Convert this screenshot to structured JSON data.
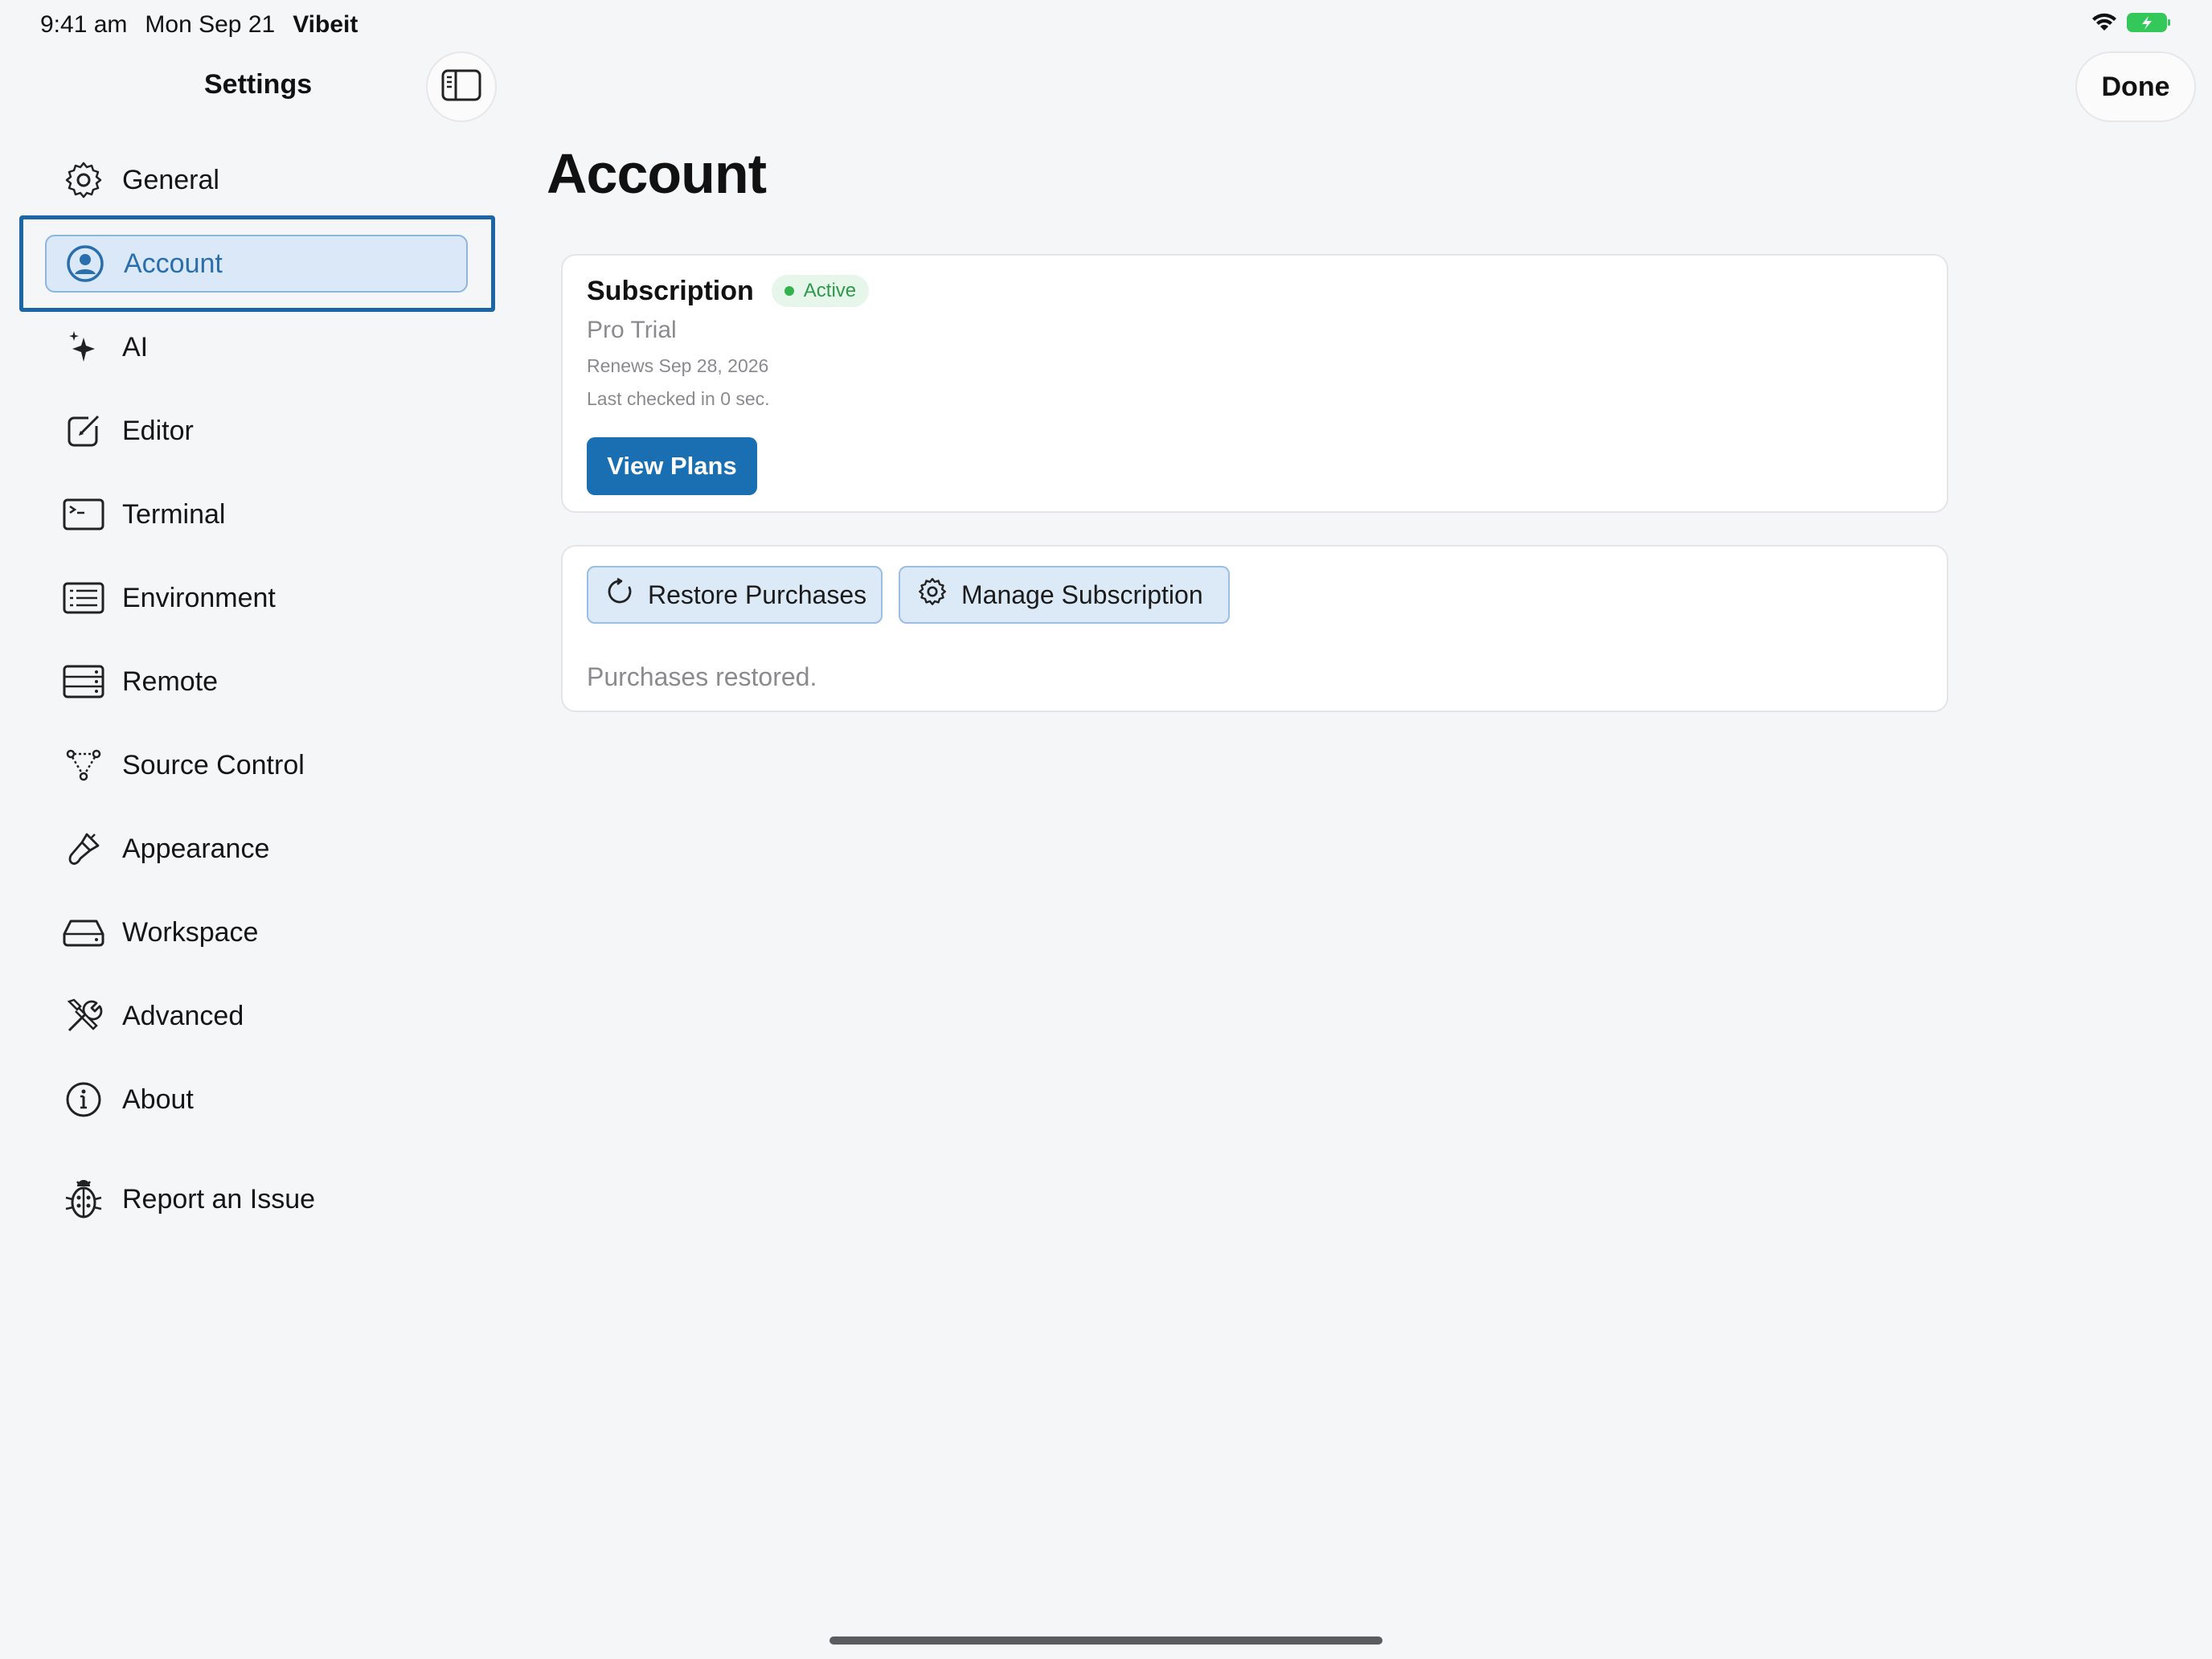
{
  "status_bar": {
    "time": "9:41 am",
    "date": "Mon Sep 21",
    "app": "Vibeit",
    "battery_color": "#34c759"
  },
  "sidebar": {
    "title": "Settings",
    "items": [
      {
        "label": "General",
        "icon": "gear-icon"
      },
      {
        "label": "Account",
        "icon": "person-circle-icon",
        "selected": true
      },
      {
        "label": "AI",
        "icon": "sparkles-icon"
      },
      {
        "label": "Editor",
        "icon": "edit-icon"
      },
      {
        "label": "Terminal",
        "icon": "terminal-icon"
      },
      {
        "label": "Environment",
        "icon": "list-icon"
      },
      {
        "label": "Remote",
        "icon": "server-icon"
      },
      {
        "label": "Source Control",
        "icon": "branch-icon"
      },
      {
        "label": "Appearance",
        "icon": "paintbrush-icon"
      },
      {
        "label": "Workspace",
        "icon": "drive-icon"
      },
      {
        "label": "Advanced",
        "icon": "tools-icon"
      },
      {
        "label": "About",
        "icon": "info-icon"
      },
      {
        "label": "Report an Issue",
        "icon": "bug-icon"
      }
    ]
  },
  "header": {
    "done_label": "Done"
  },
  "main": {
    "title": "Account",
    "subscription": {
      "title": "Subscription",
      "status": "Active",
      "plan": "Pro Trial",
      "renews": "Renews Sep 28, 2026",
      "last_checked": "Last checked in 0 sec.",
      "view_plans_label": "View Plans"
    },
    "purchases": {
      "restore_label": "Restore Purchases",
      "manage_label": "Manage Subscription",
      "message": "Purchases restored."
    }
  },
  "colors": {
    "accent": "#1a6fb2",
    "selection_bg": "#dbe8f7",
    "active_green": "#34b24f"
  }
}
